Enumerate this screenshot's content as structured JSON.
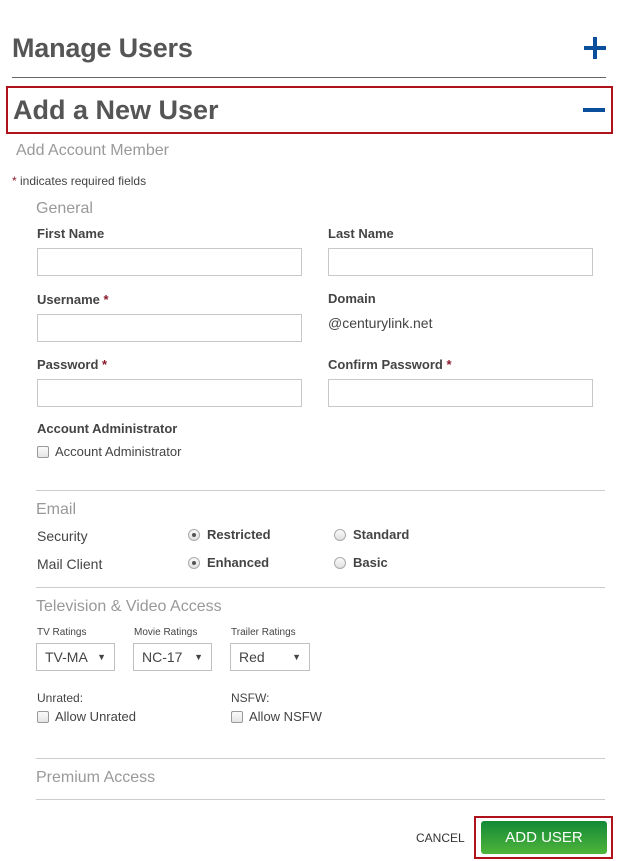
{
  "manage": {
    "title": "Manage Users",
    "toggle_icon": "plus-icon"
  },
  "add_user": {
    "title": "Add a New User",
    "toggle_icon": "minus-icon"
  },
  "subtitle": "Add Account Member",
  "required_note": {
    "star": "*",
    "text": " indicates required fields"
  },
  "general": {
    "title": "General",
    "first_name": {
      "label": "First Name",
      "value": ""
    },
    "last_name": {
      "label": "Last Name",
      "value": ""
    },
    "username": {
      "label": "Username",
      "required": "*",
      "value": ""
    },
    "domain": {
      "label": "Domain",
      "value": "@centurylink.net"
    },
    "password": {
      "label": "Password",
      "required": "*",
      "value": ""
    },
    "confirm_password": {
      "label": "Confirm Password",
      "required": "*",
      "value": ""
    },
    "account_admin": {
      "label": "Account Administrator",
      "checkbox_label": "Account Administrator",
      "checked": false
    }
  },
  "email": {
    "title": "Email",
    "security": {
      "label": "Security",
      "options": [
        "Restricted",
        "Standard"
      ],
      "selected": "Restricted"
    },
    "mail_client": {
      "label": "Mail Client",
      "options": [
        "Enhanced",
        "Basic"
      ],
      "selected": "Enhanced"
    }
  },
  "tv": {
    "title": "Television & Video Access",
    "tv_ratings": {
      "label": "TV Ratings",
      "value": "TV-MA"
    },
    "movie_ratings": {
      "label": "Movie Ratings",
      "value": "NC-17"
    },
    "trailer_ratings": {
      "label": "Trailer Ratings",
      "value": "Red"
    },
    "caret": "▼",
    "unrated": {
      "label": "Unrated:",
      "checkbox_label": "Allow Unrated",
      "checked": false
    },
    "nsfw": {
      "label": "NSFW:",
      "checkbox_label": "Allow NSFW",
      "checked": false
    }
  },
  "premium": {
    "title": "Premium Access"
  },
  "actions": {
    "cancel": "CANCEL",
    "add_user": "ADD USER"
  },
  "colors": {
    "accent_blue": "#0b4f9c",
    "highlight_red": "#b0121b",
    "button_green": "#2e9e38",
    "required_star": "#8b1a2b"
  }
}
